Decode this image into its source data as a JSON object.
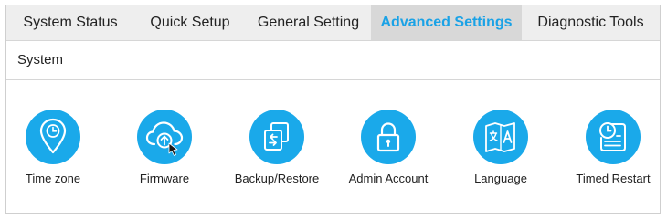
{
  "tabs": [
    {
      "label": "System Status",
      "active": false
    },
    {
      "label": "Quick Setup",
      "active": false
    },
    {
      "label": "General Setting",
      "active": false
    },
    {
      "label": "Advanced Settings",
      "active": true
    },
    {
      "label": "Diagnostic Tools",
      "active": false
    }
  ],
  "section": {
    "title": "System"
  },
  "tools": [
    {
      "label": "Time zone",
      "icon": "map-pin-clock-icon"
    },
    {
      "label": "Firmware",
      "icon": "cloud-upload-icon"
    },
    {
      "label": "Backup/Restore",
      "icon": "backup-restore-icon"
    },
    {
      "label": "Admin Account",
      "icon": "padlock-icon"
    },
    {
      "label": "Language",
      "icon": "language-map-icon"
    },
    {
      "label": "Timed Restart",
      "icon": "timed-restart-icon"
    }
  ],
  "colors": {
    "accent": "#1aa2e6",
    "icon_circle": "#1aa9ea",
    "tab_bar": "#eeeeee",
    "active_tab": "#d8d8d8"
  }
}
